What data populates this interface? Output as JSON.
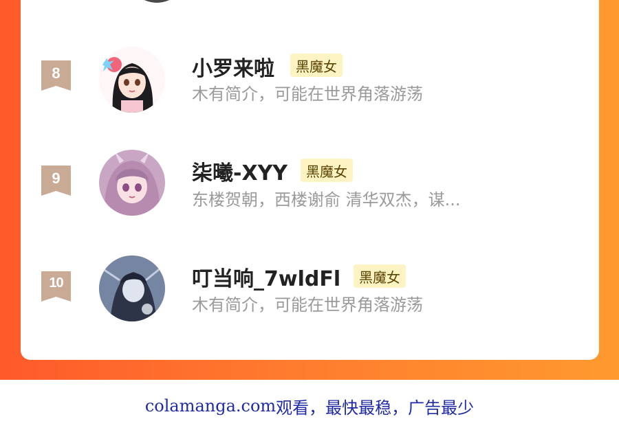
{
  "colors": {
    "frame_gradient_start": "#ff5a2a",
    "frame_gradient_end": "#ff9a2f",
    "badge": "#c9aa95",
    "tag_bg": "#fdf3c3",
    "tag_text": "#5b4300",
    "name": "#222222",
    "bio": "#9a9a9a",
    "footer_text": "#1e2aa8"
  },
  "list": {
    "items": [
      {
        "rank": "8",
        "name": "小罗来啦",
        "tag": "黑魔女",
        "bio": "木有简介，可能在世界角落游荡",
        "avatar_icon": "anime-girl-avatar-icon"
      },
      {
        "rank": "9",
        "name": "柒曦-XYY",
        "tag": "黑魔女",
        "bio": "东楼贺朝，西楼谢俞 清华双杰，谋...",
        "avatar_icon": "anime-pink-hair-avatar-icon"
      },
      {
        "rank": "10",
        "name": "叮当响_7wldFl",
        "tag": "黑魔女",
        "bio": "木有简介，可能在世界角落游荡",
        "avatar_icon": "anime-dark-figure-avatar-icon"
      }
    ]
  },
  "footer": {
    "site": "colamanga.com",
    "text": "观看，最快最稳，广告最少"
  }
}
